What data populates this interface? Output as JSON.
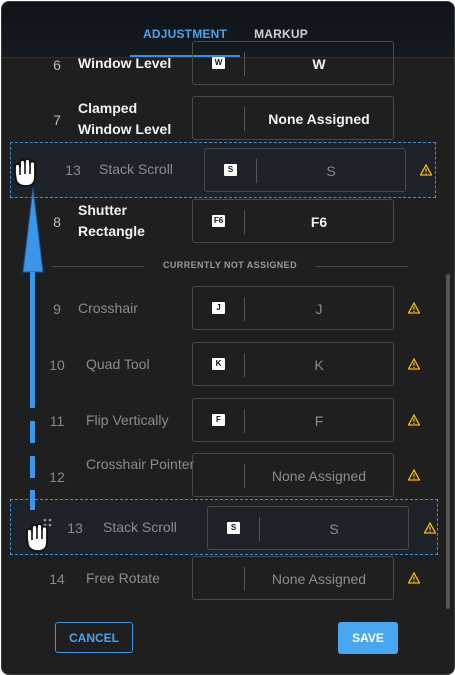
{
  "tabs": {
    "adjustment": "ADJUSTMENT",
    "markup": "MARKUP"
  },
  "divider_label": "CURRENTLY NOT ASSIGNED",
  "rows": [
    {
      "num": "6",
      "label": "Window Level",
      "key": "W",
      "value": "W"
    },
    {
      "num": "7",
      "label": "Clamped Window Level",
      "key": "",
      "value": "None Assigned"
    },
    {
      "num": "8",
      "label": "Shutter Rectangle",
      "key": "F6",
      "value": "F6"
    },
    {
      "num": "9",
      "label": "Crosshair",
      "key": "J",
      "value": "J"
    },
    {
      "num": "10",
      "label": "Quad Tool",
      "key": "K",
      "value": "K"
    },
    {
      "num": "11",
      "label": "Flip Vertically",
      "key": "F",
      "value": "F"
    },
    {
      "num": "12",
      "label": "Crosshair Pointer",
      "key": "",
      "value": "None Assigned"
    },
    {
      "num": "14",
      "label": "Free Rotate",
      "key": "",
      "value": "None Assigned"
    }
  ],
  "drag_ghost": {
    "num": "13",
    "label": "Stack Scroll",
    "key": "S",
    "value": "S"
  },
  "buttons": {
    "cancel": "CANCEL",
    "save": "SAVE"
  },
  "colors": {
    "accent": "#49a6f0",
    "warning": "#f5b800",
    "background": "#1f1f1f"
  },
  "icons": [
    "warning-icon",
    "grab-hand-icon",
    "drag-handle-icon"
  ]
}
